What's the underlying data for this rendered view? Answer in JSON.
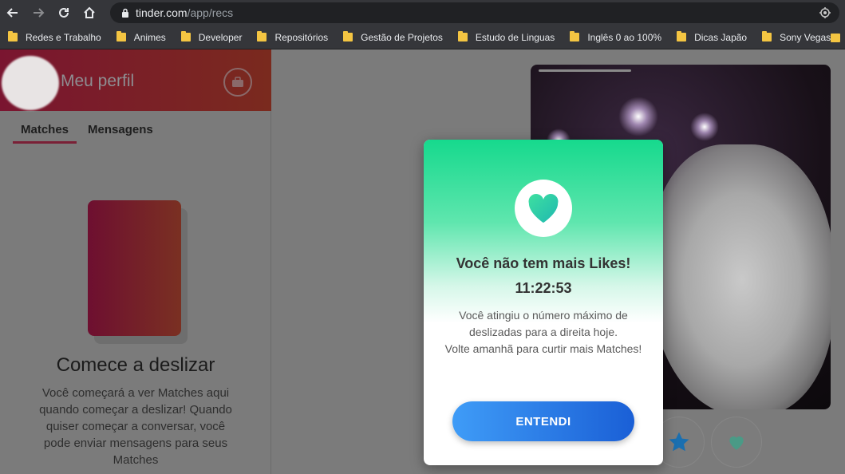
{
  "browser": {
    "url_host": "tinder.com",
    "url_path": "/app/recs",
    "bookmarks": [
      {
        "label": "Redes e Trabalho"
      },
      {
        "label": "Animes"
      },
      {
        "label": "Developer"
      },
      {
        "label": "Repositórios"
      },
      {
        "label": "Gestão de Projetos"
      },
      {
        "label": "Estudo de Linguas"
      },
      {
        "label": "Inglês 0 ao 100%"
      },
      {
        "label": "Dicas Japão"
      },
      {
        "label": "Sony Vegas"
      }
    ]
  },
  "sidebar": {
    "profile_title": "Meu perfil",
    "tabs": [
      {
        "label": "Matches",
        "active": true
      },
      {
        "label": "Mensagens",
        "active": false
      }
    ],
    "empty_title": "Comece a deslizar",
    "empty_text": "Você começará a ver Matches aqui quando começar a deslizar! Quando quiser começar a conversar, você pode enviar mensagens para seus Matches"
  },
  "modal": {
    "title": "Você não tem mais Likes!",
    "timer": "11:22:53",
    "text_line1": "Você atingiu o número máximo de",
    "text_line2": "deslizadas para a direita hoje.",
    "text_line3": "Volte amanhã para curtir mais Matches!",
    "button_label": "ENTENDI"
  },
  "colors": {
    "brand_gradient_start": "#7a1530",
    "modal_green": "#16d98d",
    "button_blue": "#1a5fd6",
    "star_blue": "#1a6fb0"
  }
}
